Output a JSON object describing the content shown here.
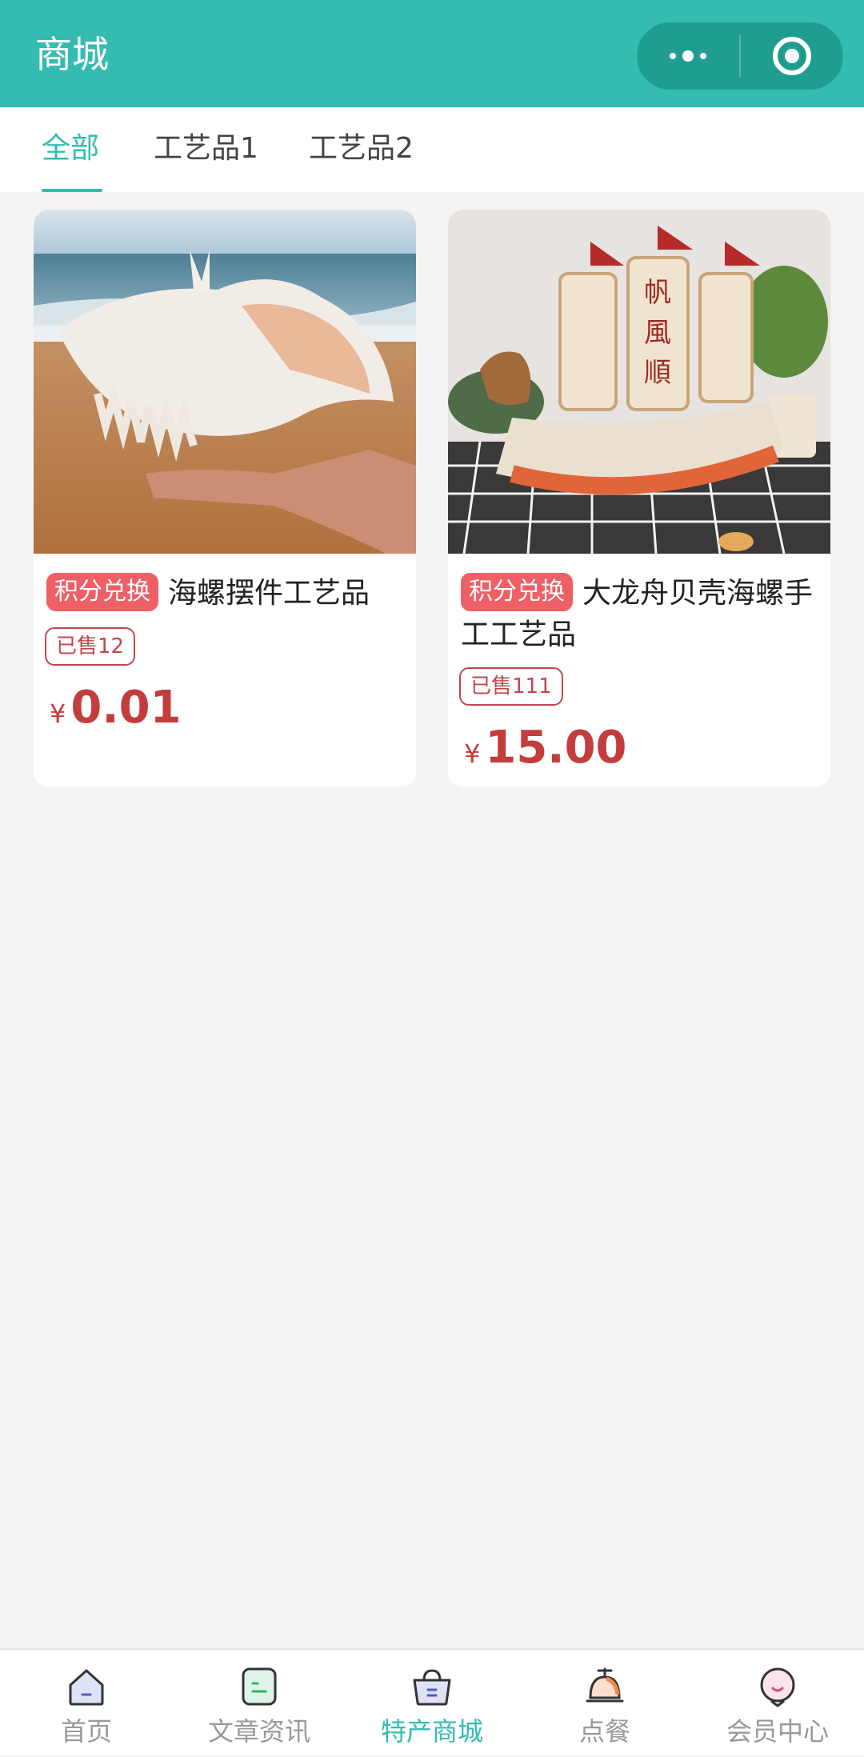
{
  "header": {
    "title": "商城"
  },
  "tabs": [
    {
      "label": "全部",
      "active": true
    },
    {
      "label": "工艺品1",
      "active": false
    },
    {
      "label": "工艺品2",
      "active": false
    }
  ],
  "products": [
    {
      "badge": "积分兑换",
      "name": "海螺摆件工艺品",
      "sold": "已售12",
      "currency": "¥",
      "price": "0.01"
    },
    {
      "badge": "积分兑换",
      "name": "大龙舟贝壳海螺手工工艺品",
      "sold": "已售111",
      "currency": "¥",
      "price": "15.00"
    }
  ],
  "tabbar": [
    {
      "label": "首页",
      "icon": "home-icon",
      "active": false
    },
    {
      "label": "文章资讯",
      "icon": "article-icon",
      "active": false
    },
    {
      "label": "特产商城",
      "icon": "shop-bag-icon",
      "active": true
    },
    {
      "label": "点餐",
      "icon": "dining-bell-icon",
      "active": false
    },
    {
      "label": "会员中心",
      "icon": "member-icon",
      "active": false
    }
  ],
  "colors": {
    "primary": "#35bcb0",
    "price": "#c33d3d",
    "badge": "#ef5f66",
    "background": "#f5f4f3"
  }
}
